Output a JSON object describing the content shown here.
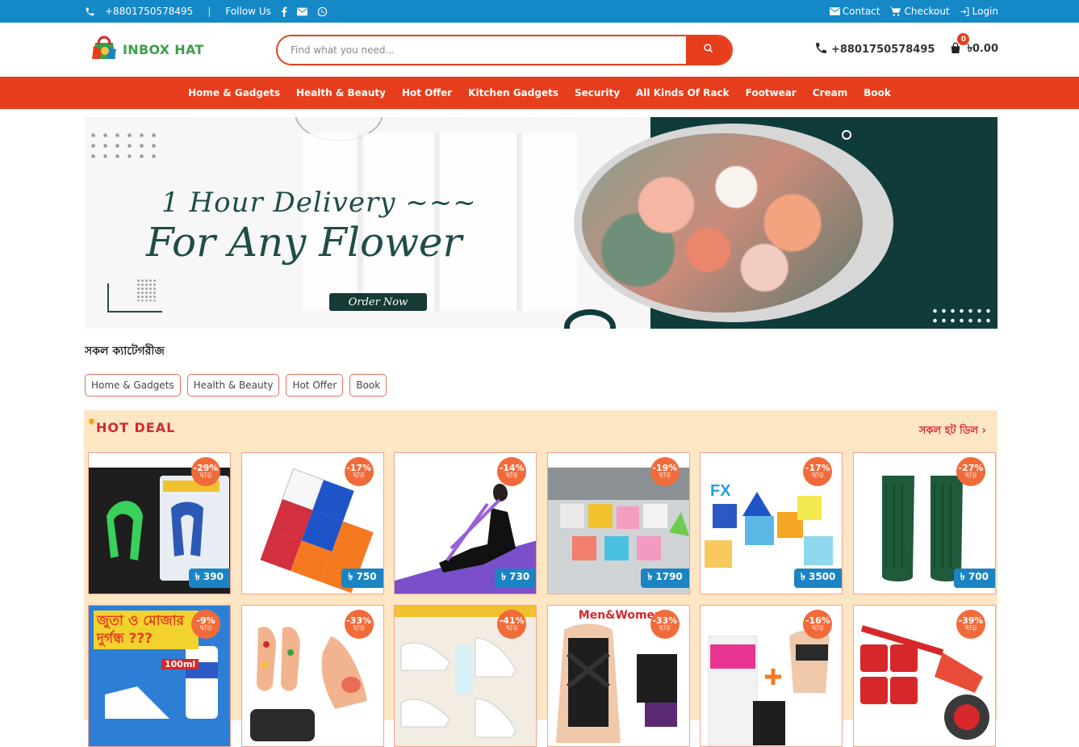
{
  "topbar": {
    "phone": "+8801750578495",
    "separator": "|",
    "follow_label": "Follow Us",
    "links": {
      "contact": "Contact",
      "checkout": "Checkout",
      "login": "Login"
    }
  },
  "header": {
    "logo_text": "INBOX HAT",
    "search_placeholder": "Find what you need...",
    "phone": "+8801750578495",
    "cart_count": "0",
    "cart_total": "৳0.00"
  },
  "nav": {
    "items": [
      "Home & Gadgets",
      "Health & Beauty",
      "Hot Offer",
      "Kitchen Gadgets",
      "Security",
      "All Kinds Of Rack",
      "Footwear",
      "Cream",
      "Book"
    ]
  },
  "banner": {
    "line1": "1 Hour Delivery ~~~",
    "line2": "For Any Flower",
    "button": "Order Now"
  },
  "categories": {
    "title": "সকল ক্যাটেগরীজ",
    "chips": [
      "Home & Gadgets",
      "Health & Beauty",
      "Hot Offer",
      "Book"
    ]
  },
  "hot_deal": {
    "title": "HOT DEAL",
    "view_all": "সকল হট ডিল ›",
    "off_label": "ছাড়",
    "products": [
      {
        "discount": "-29%",
        "price": "৳ 390",
        "image": "hand-grip-exerciser"
      },
      {
        "discount": "-17%",
        "price": "৳ 750",
        "image": "rubiks-cube"
      },
      {
        "discount": "-14%",
        "price": "৳ 730",
        "image": "resistance-band-yoga"
      },
      {
        "discount": "-19%",
        "price": "৳ 1790",
        "image": "cube-collection"
      },
      {
        "discount": "-17%",
        "price": "৳ 3500",
        "image": "puzzle-cube-set"
      },
      {
        "discount": "-27%",
        "price": "৳ 700",
        "image": "cricket-leg-pads"
      },
      {
        "discount": "-9%",
        "price": "",
        "image": "shoe-deodorant-spray"
      },
      {
        "discount": "-33%",
        "price": "",
        "image": "reflexology-foot-mat"
      },
      {
        "discount": "-41%",
        "price": "",
        "image": "shoe-cleaner"
      },
      {
        "discount": "-33%",
        "price": "",
        "image": "posture-corrector-belt"
      },
      {
        "discount": "-16%",
        "price": "",
        "image": "slimming-gel-kit"
      },
      {
        "discount": "-39%",
        "price": "",
        "image": "furniture-mover-tool"
      }
    ],
    "product6_text": "জুতা ও মোজার দুর্গন্ধ ???",
    "product6_volume": "100ml",
    "product9_text": "Men&Women"
  },
  "colors": {
    "topbar": "#1588c8",
    "accent": "#e63e1c",
    "price_tag": "#1b84c3",
    "discount": "#f16b3a",
    "hot_deal_bg": "#fde6c4",
    "logo_green": "#3aa14a"
  }
}
